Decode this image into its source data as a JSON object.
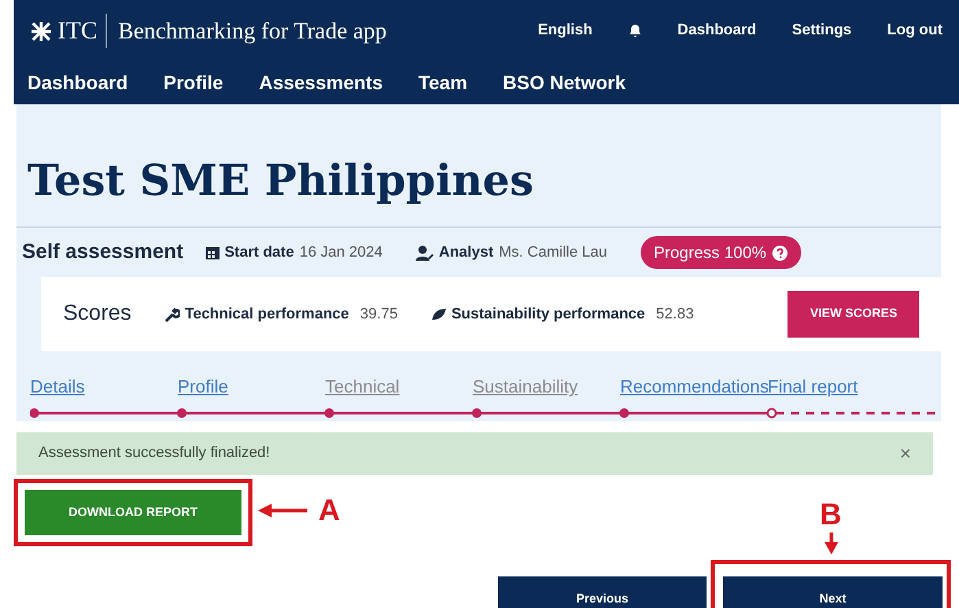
{
  "header": {
    "brand": "ITC",
    "app_name": "Benchmarking for Trade app",
    "links": [
      {
        "label": "English",
        "kind": "text"
      },
      {
        "kind": "bell"
      },
      {
        "label": "Dashboard",
        "kind": "text"
      },
      {
        "label": "Settings",
        "kind": "text"
      },
      {
        "label": "Log out",
        "kind": "text"
      }
    ]
  },
  "nav": [
    {
      "label": "Dashboard"
    },
    {
      "label": "Profile"
    },
    {
      "label": "Assessments"
    },
    {
      "label": "Team"
    },
    {
      "label": "BSO Network"
    }
  ],
  "title": "Test SME Philippines",
  "assessment": {
    "name": "Self assessment",
    "start_label": "Start date",
    "start_date": "16 Jan 2024",
    "analyst_label": "Analyst",
    "analyst": "Ms. Camille Lau",
    "progress": "Progress 100%"
  },
  "scores": {
    "title": "Scores",
    "technical_label": "Technical performance",
    "technical": "39.75",
    "sustainability_label": "Sustainability performance",
    "sustainability": "52.83",
    "button": "VIEW SCORES"
  },
  "steps": [
    {
      "label": "Details",
      "disabled": false,
      "selected": false
    },
    {
      "label": "Profile",
      "disabled": false,
      "selected": false
    },
    {
      "label": "Technical",
      "disabled": true,
      "selected": false
    },
    {
      "label": "Sustainability",
      "disabled": true,
      "selected": false
    },
    {
      "label": "Recommendations",
      "disabled": false,
      "selected": false
    },
    {
      "label": "Final report",
      "disabled": false,
      "selected": true
    }
  ],
  "alert": {
    "message": "Assessment successfully finalized!",
    "close": "×"
  },
  "download_button": "DOWNLOAD REPORT",
  "buttons": [
    {
      "label": "Previous"
    },
    {
      "label": "Next"
    }
  ],
  "annotations": [
    {
      "label": "A"
    },
    {
      "label": "B"
    }
  ]
}
